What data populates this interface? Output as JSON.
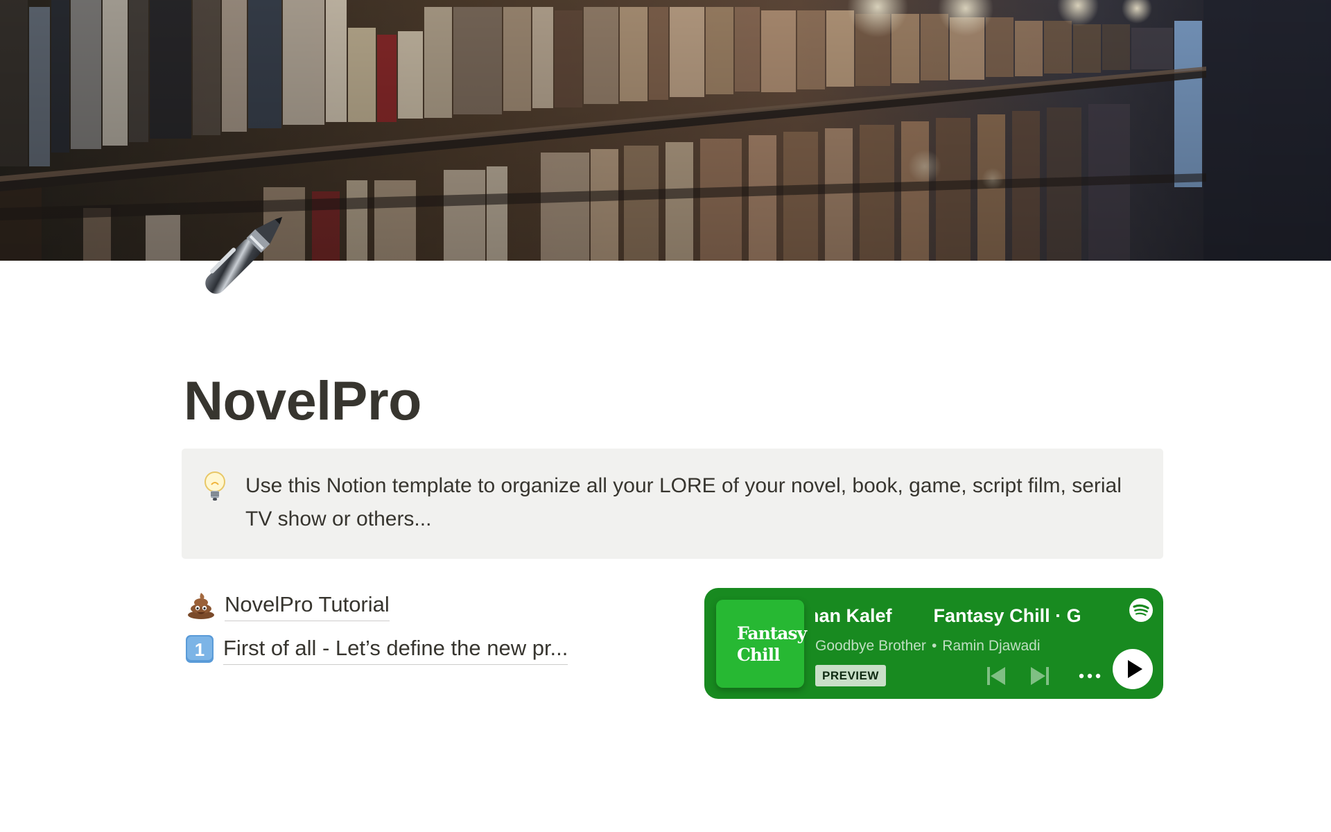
{
  "cover": {
    "image": "library-bookshelves-photo"
  },
  "page": {
    "icon": "pen-icon",
    "title": "NovelPro"
  },
  "callout": {
    "icon": "lightbulb-icon",
    "text": "Use this Notion template to organize all your LORE of your novel, book, game, script film, serial TV show or others..."
  },
  "links": [
    {
      "icon": "pile-of-poo-icon",
      "label": "NovelPro Tutorial"
    },
    {
      "icon": "keycap-1-icon",
      "label": "First of all - Let’s define the new pr..."
    }
  ],
  "spotify": {
    "cover_line1": "Fantasy",
    "cover_line2": "Chill",
    "marquee_1": "nan Kalef",
    "marquee_2": "Fantasy Chill · G",
    "track": "Goodbye Brother",
    "separator": "•",
    "artist": "Ramin Djawadi",
    "preview_label": "PREVIEW",
    "colors": {
      "background": "#188a20",
      "cover": "#27b833"
    }
  }
}
